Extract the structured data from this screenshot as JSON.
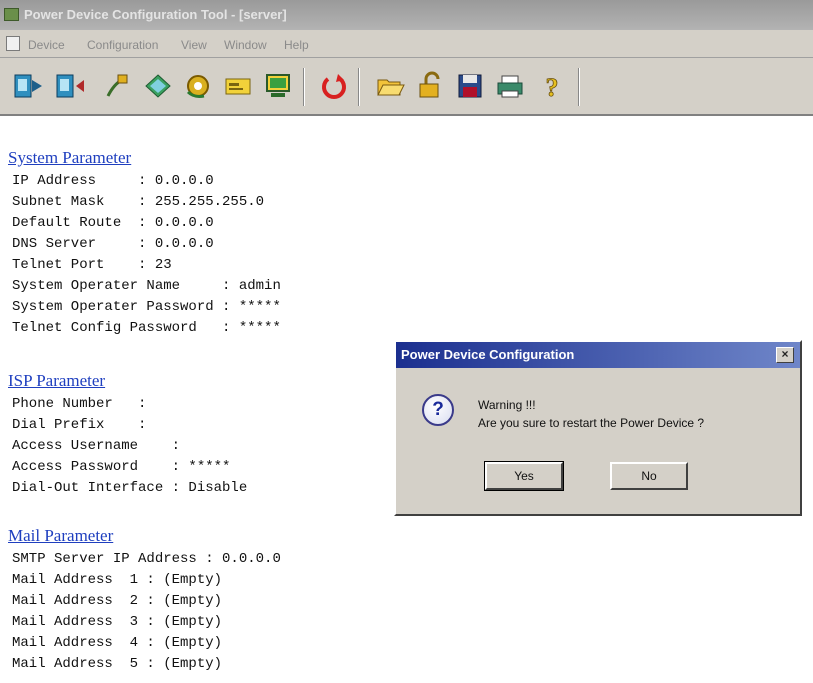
{
  "window": {
    "title": "Power Device Configuration Tool - [server]"
  },
  "menu": [
    "Device",
    "Configuration",
    "View",
    "Window",
    "Help"
  ],
  "toolbar": {
    "icons": [
      "connect-icon",
      "disconnect-icon",
      "plug-icon",
      "diamond-icon",
      "gear-icon",
      "card-icon",
      "monitor-icon",
      "restart-icon",
      "open-folder-icon",
      "unlock-icon",
      "save-icon",
      "print-icon",
      "help-icon"
    ]
  },
  "system": {
    "heading": "System Parameter",
    "lines": [
      "IP Address     : 0.0.0.0",
      "Subnet Mask    : 255.255.255.0",
      "Default Route  : 0.0.0.0",
      "DNS Server     : 0.0.0.0",
      "Telnet Port    : 23",
      "System Operater Name     : admin",
      "System Operater Password : *****",
      "Telnet Config Password   : *****"
    ]
  },
  "isp": {
    "heading": "ISP Parameter",
    "lines": [
      "Phone Number   :",
      "Dial Prefix    :",
      "Access Username    :",
      "Access Password    : *****",
      "Dial-Out Interface : Disable"
    ]
  },
  "mail": {
    "heading": "Mail Parameter",
    "lines": [
      "SMTP Server IP Address : 0.0.0.0",
      "Mail Address  1 : (Empty)",
      "Mail Address  2 : (Empty)",
      "Mail Address  3 : (Empty)",
      "Mail Address  4 : (Empty)",
      "Mail Address  5 : (Empty)"
    ]
  },
  "dialog": {
    "title": "Power Device Configuration",
    "close": "×",
    "icon": "question-icon",
    "message_line1": "Warning !!!",
    "message_line2": "Are you sure to restart the Power Device ?",
    "yes_label": "Yes",
    "no_label": "No"
  }
}
